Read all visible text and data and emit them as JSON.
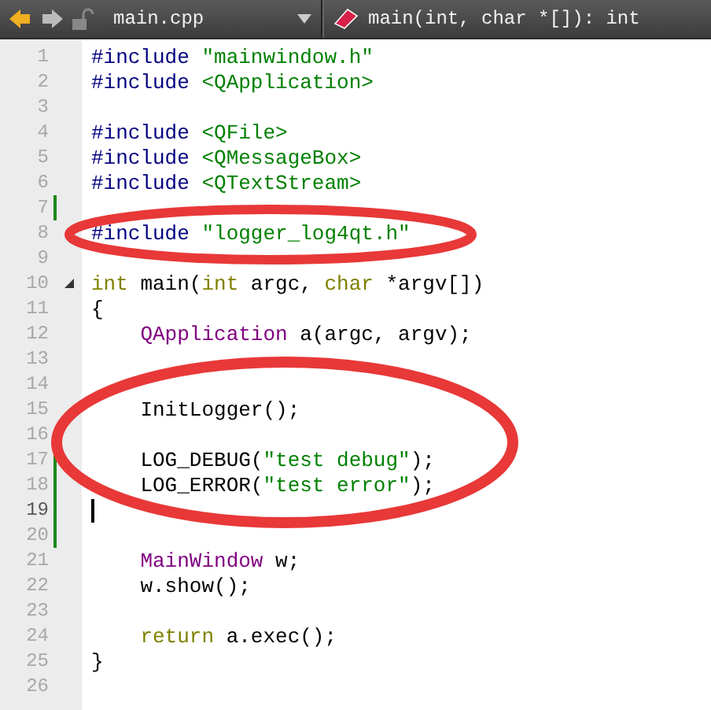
{
  "toolbar": {
    "file": "main.cpp",
    "symbol": "main(int, char *[]): int"
  },
  "lines": [
    {
      "number": "1",
      "changed": false,
      "foldable": false,
      "cursor": false,
      "tokens": [
        {
          "kind": "preprocessor",
          "text": "#include"
        },
        {
          "kind": "string",
          "text": " \"mainwindow.h\""
        }
      ]
    },
    {
      "number": "2",
      "changed": false,
      "foldable": false,
      "cursor": false,
      "tokens": [
        {
          "kind": "preprocessor",
          "text": "#include"
        },
        {
          "kind": "string",
          "text": " <QApplication>"
        }
      ]
    },
    {
      "number": "3",
      "changed": false,
      "foldable": false,
      "cursor": false
    },
    {
      "number": "4",
      "changed": false,
      "foldable": false,
      "cursor": false,
      "tokens": [
        {
          "kind": "preprocessor",
          "text": "#include"
        },
        {
          "kind": "string",
          "text": " <QFile>"
        }
      ]
    },
    {
      "number": "5",
      "changed": false,
      "foldable": false,
      "cursor": false,
      "tokens": [
        {
          "kind": "preprocessor",
          "text": "#include"
        },
        {
          "kind": "string",
          "text": " <QMessageBox>"
        }
      ]
    },
    {
      "number": "6",
      "changed": false,
      "foldable": false,
      "cursor": false,
      "tokens": [
        {
          "kind": "preprocessor",
          "text": "#include"
        },
        {
          "kind": "string",
          "text": " <QTextStream>"
        }
      ]
    },
    {
      "number": "7",
      "changed": true,
      "foldable": false,
      "cursor": false
    },
    {
      "number": "8",
      "changed": false,
      "foldable": false,
      "cursor": false,
      "tokens": [
        {
          "kind": "preprocessor",
          "text": "#include"
        },
        {
          "kind": "string",
          "text": " \"logger_log4qt.h\""
        }
      ]
    },
    {
      "number": "9",
      "changed": false,
      "foldable": false,
      "cursor": false
    },
    {
      "number": "10",
      "changed": false,
      "foldable": true,
      "cursor": false,
      "tokens": [
        {
          "kind": "keyword",
          "text": "int"
        },
        {
          "kind": "plain",
          "text": " main("
        },
        {
          "kind": "keyword",
          "text": "int"
        },
        {
          "kind": "plain",
          "text": " argc, "
        },
        {
          "kind": "keyword",
          "text": "char"
        },
        {
          "kind": "plain",
          "text": " *argv[])"
        }
      ]
    },
    {
      "number": "11",
      "changed": false,
      "foldable": false,
      "cursor": false,
      "tokens": [
        {
          "kind": "plain",
          "text": "{"
        }
      ]
    },
    {
      "number": "12",
      "changed": false,
      "foldable": false,
      "cursor": false,
      "tokens": [
        {
          "kind": "type",
          "text": "    QApplication"
        },
        {
          "kind": "plain",
          "text": " a(argc, argv);"
        }
      ]
    },
    {
      "number": "13",
      "changed": false,
      "foldable": false,
      "cursor": false
    },
    {
      "number": "14",
      "changed": false,
      "foldable": false,
      "cursor": false
    },
    {
      "number": "15",
      "changed": false,
      "foldable": false,
      "cursor": false,
      "tokens": [
        {
          "kind": "plain",
          "text": "    InitLogger();"
        }
      ]
    },
    {
      "number": "16",
      "changed": false,
      "foldable": false,
      "cursor": false
    },
    {
      "number": "17",
      "changed": true,
      "foldable": false,
      "cursor": false,
      "tokens": [
        {
          "kind": "plain",
          "text": "    LOG_DEBUG("
        },
        {
          "kind": "string",
          "text": "\"test debug\""
        },
        {
          "kind": "plain",
          "text": ");"
        }
      ]
    },
    {
      "number": "18",
      "changed": true,
      "foldable": false,
      "cursor": false,
      "tokens": [
        {
          "kind": "plain",
          "text": "    LOG_ERROR("
        },
        {
          "kind": "string",
          "text": "\"test error\""
        },
        {
          "kind": "plain",
          "text": ");"
        }
      ]
    },
    {
      "number": "19",
      "changed": true,
      "foldable": false,
      "cursor": true
    },
    {
      "number": "20",
      "changed": true,
      "foldable": false,
      "cursor": false
    },
    {
      "number": "21",
      "changed": false,
      "foldable": false,
      "cursor": false,
      "tokens": [
        {
          "kind": "type",
          "text": "    MainWindow"
        },
        {
          "kind": "plain",
          "text": " w;"
        }
      ]
    },
    {
      "number": "22",
      "changed": false,
      "foldable": false,
      "cursor": false,
      "tokens": [
        {
          "kind": "plain",
          "text": "    w.show();"
        }
      ]
    },
    {
      "number": "23",
      "changed": false,
      "foldable": false,
      "cursor": false
    },
    {
      "number": "24",
      "changed": false,
      "foldable": false,
      "cursor": false,
      "tokens": [
        {
          "kind": "keyword",
          "text": "    return"
        },
        {
          "kind": "plain",
          "text": " a.exec();"
        }
      ]
    },
    {
      "number": "25",
      "changed": false,
      "foldable": false,
      "cursor": false,
      "tokens": [
        {
          "kind": "plain",
          "text": "}"
        }
      ]
    },
    {
      "number": "26",
      "changed": false,
      "foldable": false,
      "cursor": false
    }
  ]
}
